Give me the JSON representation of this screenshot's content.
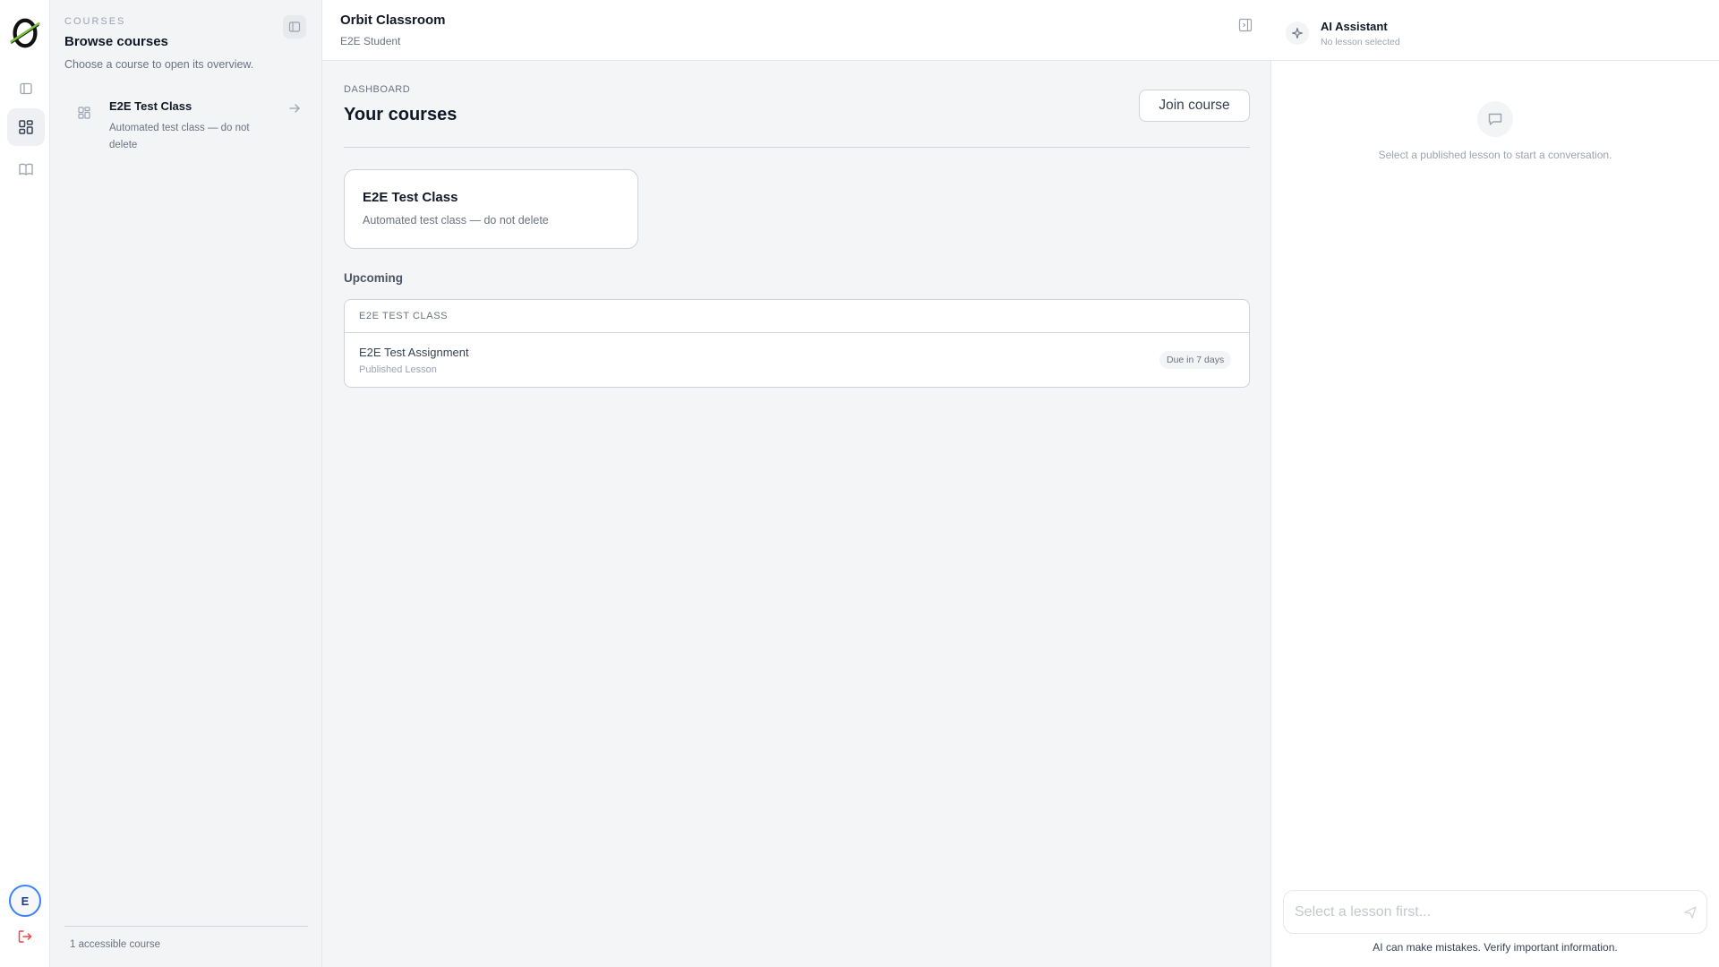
{
  "rail": {
    "avatar_initial": "E",
    "icons": [
      "orbit-logo",
      "sidebar-toggle-icon",
      "dashboard-icon",
      "book-icon",
      "logout-icon"
    ]
  },
  "courses": {
    "kicker": "COURSES",
    "title": "Browse courses",
    "subtitle": "Choose a course to open its overview.",
    "items": [
      {
        "name": "E2E Test Class",
        "description": "Automated test class — do not delete"
      }
    ],
    "footer": "1 accessible course"
  },
  "header": {
    "title": "Orbit Classroom",
    "subtitle": "E2E Student"
  },
  "dashboard": {
    "kicker": "DASHBOARD",
    "title": "Your courses",
    "join_label": "Join course",
    "cards": [
      {
        "name": "E2E Test Class",
        "description": "Automated test class — do not delete"
      }
    ],
    "upcoming_label": "Upcoming",
    "upcoming": {
      "group": "E2E TEST CLASS",
      "items": [
        {
          "name": "E2E Test Assignment",
          "type": "Published Lesson",
          "due": "Due in 7 days"
        }
      ]
    }
  },
  "assistant": {
    "title": "AI Assistant",
    "subtitle": "No lesson selected",
    "empty_message": "Select a published lesson to start a conversation.",
    "input_placeholder": "Select a lesson first...",
    "disclaimer": "AI can make mistakes. Verify important information."
  },
  "colors": {
    "accent": "#3b82f6",
    "logo_green": "#7cc23a",
    "logout_red": "#ef4444",
    "main_bg": "#f4f5f7"
  }
}
